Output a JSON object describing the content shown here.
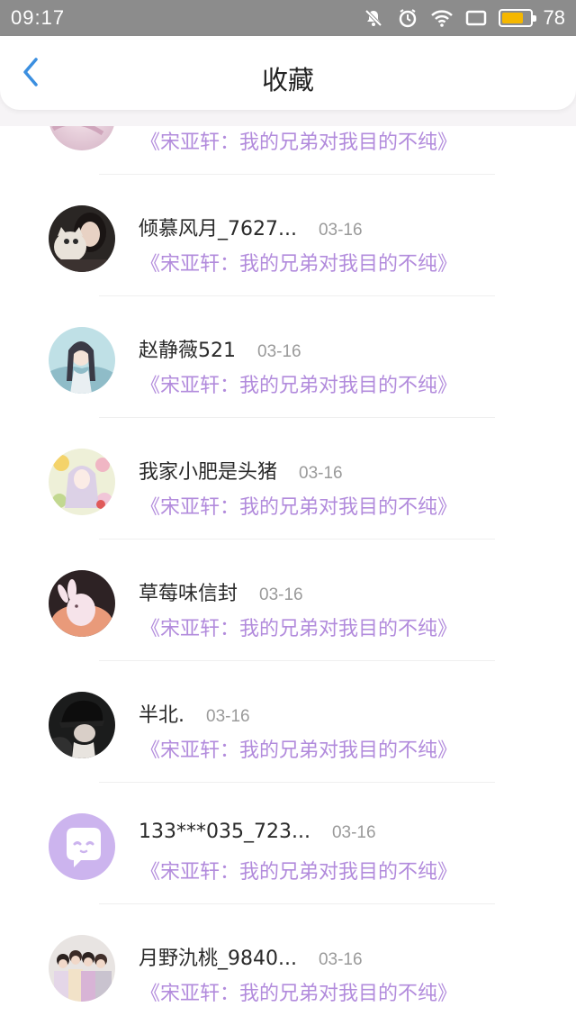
{
  "status_bar": {
    "time": "09:17",
    "battery": "78",
    "battery_level": 0.78,
    "icons": [
      "mute-bell-icon",
      "alarm-icon",
      "wifi-icon",
      "screen-icon",
      "battery-icon"
    ]
  },
  "header": {
    "title": "收藏",
    "back_icon": "chevron-left-icon",
    "accent": "#3b8fe0"
  },
  "colors": {
    "link": "#b28bdc",
    "name": "#2a2a2a",
    "date": "#9a9a9a",
    "status_bar_bg": "#8c8c8c"
  },
  "items": [
    {
      "name": "",
      "date": "",
      "book": "《宋亚轩：我的兄弟对我目的不纯》",
      "avatar": "avatar-partial"
    },
    {
      "name": "倾慕风月_7627...",
      "date": "03-16",
      "book": "《宋亚轩：我的兄弟对我目的不纯》",
      "avatar": "avatar-girl-cat"
    },
    {
      "name": "赵静薇521",
      "date": "03-16",
      "book": "《宋亚轩：我的兄弟对我目的不纯》",
      "avatar": "avatar-illustration"
    },
    {
      "name": "我家小肥是头猪",
      "date": "03-16",
      "book": "《宋亚轩：我的兄弟对我目的不纯》",
      "avatar": "avatar-flowers"
    },
    {
      "name": "草莓味信封",
      "date": "03-16",
      "book": "《宋亚轩：我的兄弟对我目的不纯》",
      "avatar": "avatar-rabbit"
    },
    {
      "name": "半北.",
      "date": "03-16",
      "book": "《宋亚轩：我的兄弟对我目的不纯》",
      "avatar": "avatar-dark"
    },
    {
      "name": "133***035_723...",
      "date": "03-16",
      "book": "《宋亚轩：我的兄弟对我目的不纯》",
      "avatar": "avatar-default-chat"
    },
    {
      "name": "月野氿桃_9840...",
      "date": "03-16",
      "book": "《宋亚轩：我的兄弟对我目的不纯》",
      "avatar": "avatar-group"
    }
  ]
}
